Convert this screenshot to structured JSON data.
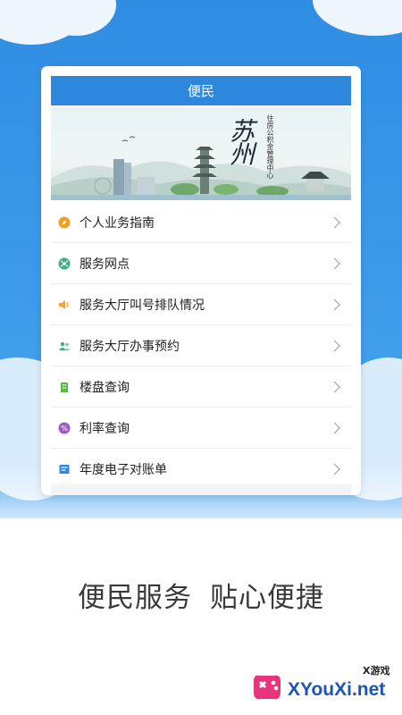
{
  "card": {
    "header_title": "便民"
  },
  "banner": {
    "title": "苏州",
    "subtitle": "住房公积金管理中心"
  },
  "menu": {
    "items": [
      {
        "label": "个人业务指南",
        "icon": "compass-icon",
        "color": "#f0a020"
      },
      {
        "label": "服务网点",
        "icon": "network-icon",
        "color": "#3bb07a"
      },
      {
        "label": "服务大厅叫号排队情况",
        "icon": "speaker-icon",
        "color": "#f3a23a"
      },
      {
        "label": "服务大厅办事预约",
        "icon": "users-icon",
        "color": "#3bb07a"
      },
      {
        "label": "楼盘查询",
        "icon": "building-icon",
        "color": "#5cb84a"
      },
      {
        "label": "利率查询",
        "icon": "percent-icon",
        "color": "#a05ac8"
      },
      {
        "label": "年度电子对账单",
        "icon": "bill-icon",
        "color": "#2d87dd"
      }
    ]
  },
  "tagline": {
    "part1": "便民服务",
    "part2": "贴心便捷"
  },
  "watermark": {
    "text": "XYouXi.net",
    "sub": "X游戏"
  },
  "colors": {
    "header_blue": "#2d87dd",
    "background_blue": "#3a98e8"
  }
}
